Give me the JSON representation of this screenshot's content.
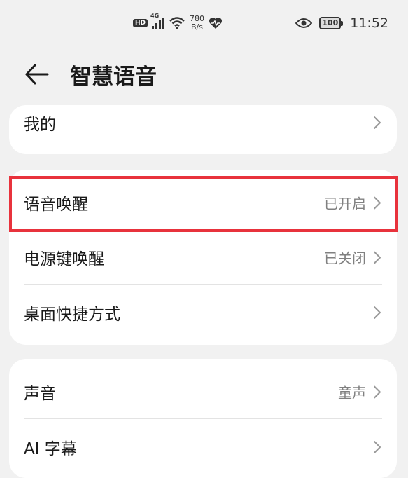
{
  "status_bar": {
    "hd_badge": "HD",
    "network_type": "4G",
    "speed_value": "780",
    "speed_unit": "B/s",
    "battery": "100",
    "time": "11:52",
    "icons": [
      "hd-icon",
      "signal-icon",
      "wifi-icon",
      "health-icon",
      "eye-icon",
      "battery-icon"
    ]
  },
  "header": {
    "back_icon": "back-arrow-icon",
    "title": "智慧语音"
  },
  "sections": [
    {
      "items": [
        {
          "label": "我的",
          "value": ""
        }
      ]
    },
    {
      "items": [
        {
          "label": "语音唤醒",
          "value": "已开启"
        },
        {
          "label": "电源键唤醒",
          "value": "已关闭"
        },
        {
          "label": "桌面快捷方式",
          "value": ""
        }
      ]
    },
    {
      "items": [
        {
          "label": "声音",
          "value": "童声"
        },
        {
          "label": "AI 字幕",
          "value": ""
        }
      ]
    }
  ],
  "colors": {
    "background": "#f1f1f1",
    "card": "#ffffff",
    "highlight_border": "#e8323c",
    "secondary_text": "#808080"
  }
}
